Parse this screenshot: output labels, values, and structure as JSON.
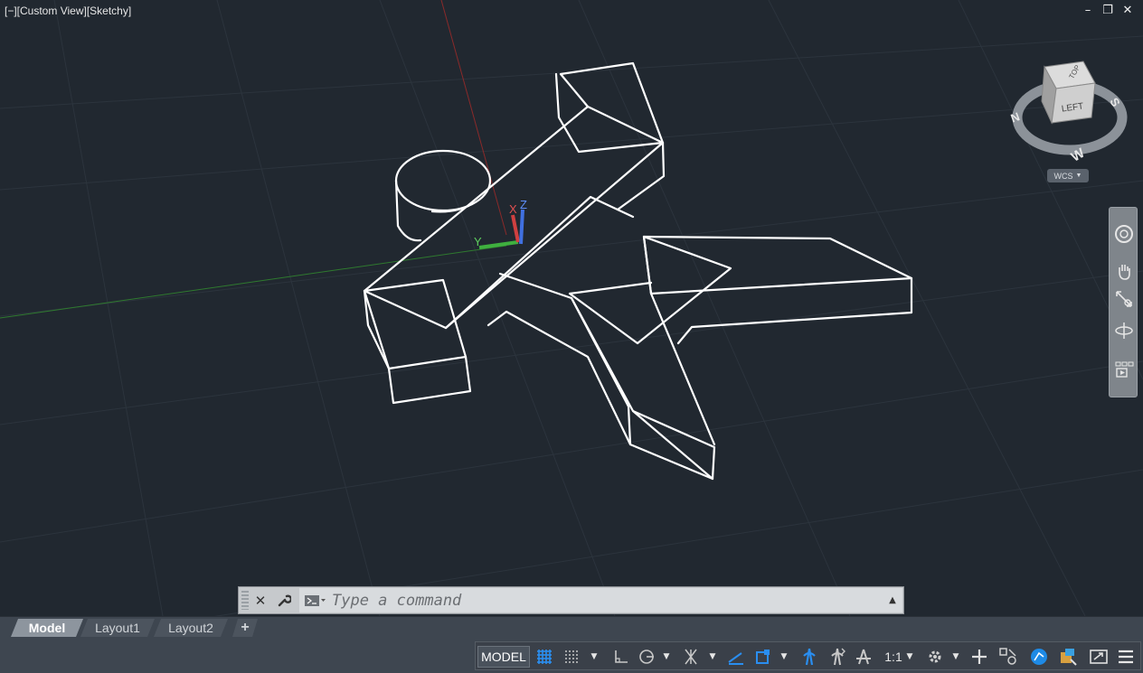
{
  "viewport": {
    "label": "[−][Custom View][Sketchy]",
    "window_controls": [
      "–",
      "❐",
      "✕"
    ]
  },
  "view_cube": {
    "face_top": "TOP",
    "face_front": "LEFT",
    "compass": {
      "n": "N",
      "s": "S",
      "w": "W"
    },
    "wcs_label": "WCS"
  },
  "ucs": {
    "x": "X",
    "y": "Y",
    "z": "Z"
  },
  "navbar": {
    "tools": [
      "steering-wheel-icon",
      "pan-hand-icon",
      "zoom-extents-icon",
      "orbit-icon",
      "showmotion-icon"
    ]
  },
  "command_line": {
    "close_icon": "close-icon",
    "customize_icon": "wrench-icon",
    "placeholder": "Type a command"
  },
  "layout_tabs": {
    "tabs": [
      "Model",
      "Layout1",
      "Layout2"
    ],
    "active": "Model",
    "add_label": "+"
  },
  "status_bar": {
    "model_label": "MODEL",
    "annotation_scale": "1:1",
    "tools": [
      "grid-icon",
      "snap-icon",
      "ortho-icon",
      "polar-icon",
      "isodraft-icon",
      "osnap-track-icon",
      "osnap-icon",
      "annotation-visibility-icon",
      "autoscale-icon",
      "annotation-scale-icon",
      "workspace-icon",
      "annotation-monitor-icon",
      "units-icon",
      "quick-properties-icon",
      "lock-ui-icon",
      "isolate-icon",
      "hardware-accel-icon",
      "clean-screen-icon",
      "customization-icon"
    ]
  },
  "colors": {
    "background": "#212830",
    "accent_blue": "#1e8ae6",
    "x_axis": "#c83030",
    "y_axis": "#30a030",
    "z_axis": "#3060d0"
  }
}
